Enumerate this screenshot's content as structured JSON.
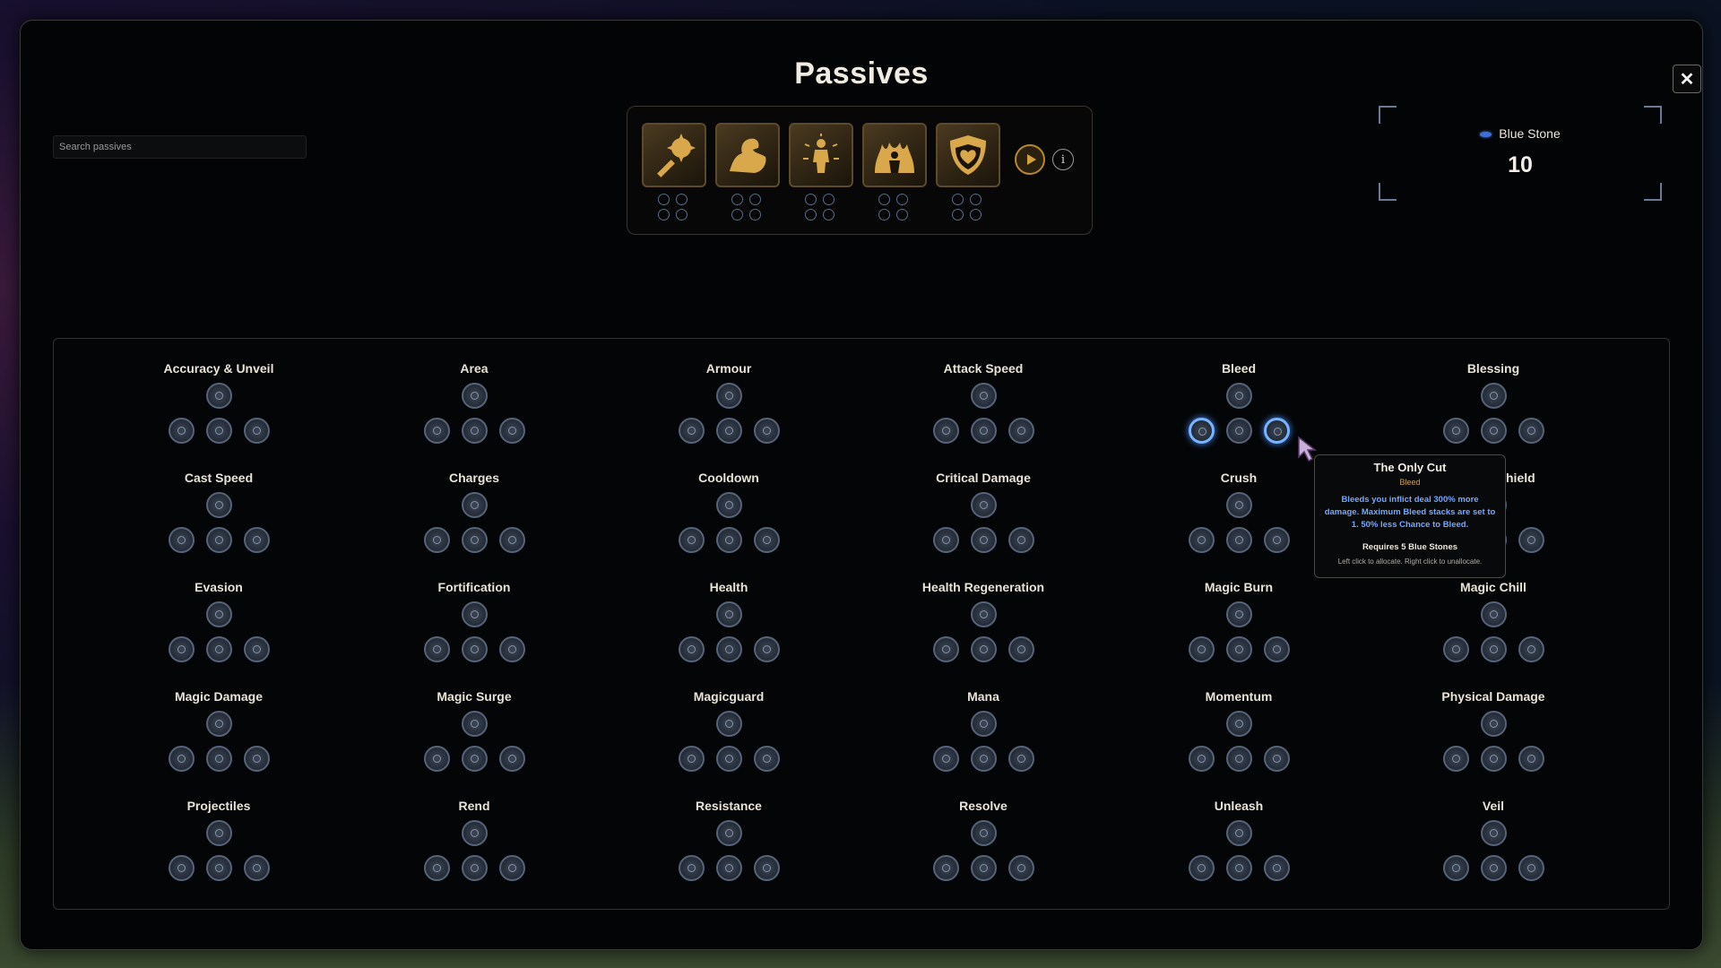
{
  "title": "Passives",
  "close_label": "✕",
  "search": {
    "placeholder": "Search passives"
  },
  "class_tree": {
    "classes": [
      {
        "name": "mace-icon"
      },
      {
        "name": "strength-arm-icon"
      },
      {
        "name": "radiant-figure-icon"
      },
      {
        "name": "flame-figure-icon"
      },
      {
        "name": "heart-shield-icon"
      }
    ],
    "play_icon": "play-icon",
    "info_label": "i"
  },
  "currency": {
    "name": "Blue Stone",
    "amount": "10",
    "color": "#3e6fd8"
  },
  "groups": [
    "Accuracy & Unveil",
    "Area",
    "Armour",
    "Attack Speed",
    "Bleed",
    "Blessing",
    "Cast Speed",
    "Charges",
    "Cooldown",
    "Critical Damage",
    "Crush",
    "Energy Shield",
    "Evasion",
    "Fortification",
    "Health",
    "Health Regeneration",
    "Magic Burn",
    "Magic Chill",
    "Magic Damage",
    "Magic Surge",
    "Magicguard",
    "Mana",
    "Momentum",
    "Physical Damage",
    "Projectiles",
    "Rend",
    "Resistance",
    "Resolve",
    "Unleash",
    "Veil"
  ],
  "tooltip": {
    "title": "The Only Cut",
    "category": "Bleed",
    "description": "Bleeds you inflict deal 300% more damage. Maximum Bleed stacks are set to 1. 50% less Chance to Bleed.",
    "requirement": "Requires 5 Blue Stones",
    "hint": "Left click to allocate. Right click to unallocate."
  },
  "colors": {
    "accent_gold": "#b8892c",
    "highlight_blue": "#79b4ff",
    "requirement_text": "#74a8ff"
  }
}
